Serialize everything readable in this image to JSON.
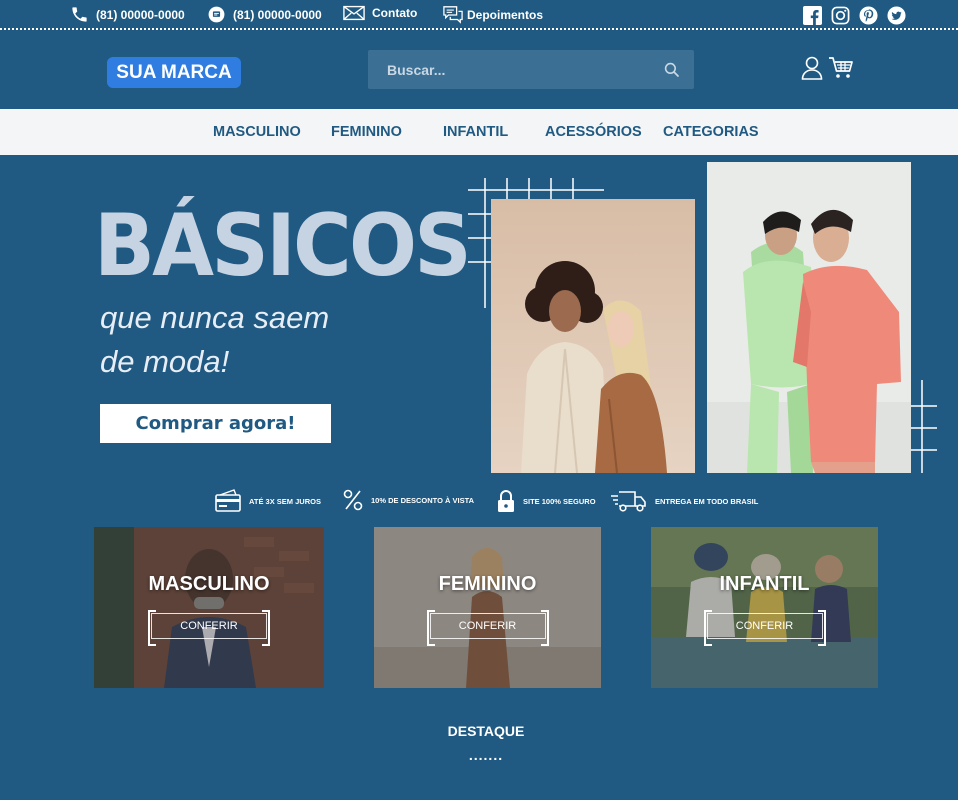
{
  "topbar": {
    "phone": "(81) 00000-0000",
    "whatsapp": "(81) 00000-0000",
    "contact": "Contato",
    "testimonials": "Depoimentos",
    "social": [
      "facebook-icon",
      "instagram-icon",
      "pinterest-icon",
      "twitter-icon"
    ]
  },
  "header": {
    "brand": "SUA MARCA",
    "search_placeholder": "Buscar..."
  },
  "nav": [
    "MASCULINO",
    "FEMININO",
    "INFANTIL",
    "ACESSÓRIOS",
    "CATEGORIAS"
  ],
  "hero": {
    "title": "BÁSICOS",
    "subtitle_line1": "que nunca saem",
    "subtitle_line2": "de moda!",
    "cta": "Comprar agora!"
  },
  "features": [
    "ATÉ 3X SEM JUROS",
    "10% DE DESCONTO À VISTA",
    "SITE 100% SEGURO",
    "ENTREGA EM TODO BRASIL"
  ],
  "categories": [
    {
      "title": "MASCULINO",
      "button": "CONFERIR"
    },
    {
      "title": "FEMININO",
      "button": "CONFERIR"
    },
    {
      "title": "INFANTIL",
      "button": "CONFERIR"
    }
  ],
  "section": {
    "title": "DESTAQUE",
    "dots": "......."
  },
  "colors": {
    "background": "#205a82",
    "brand_button": "#2f7de0",
    "nav_bg": "#f4f5f6",
    "hero_title": "#c5d3e3"
  }
}
